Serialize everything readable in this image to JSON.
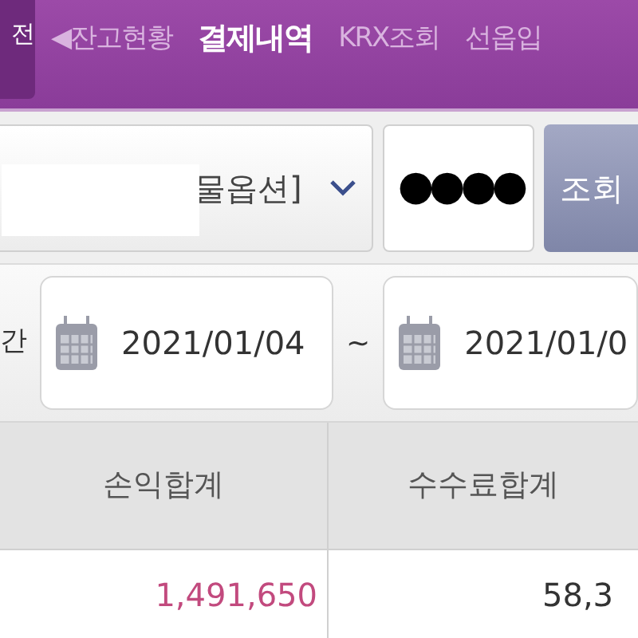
{
  "back_button": {
    "label": "전"
  },
  "tabs": [
    {
      "label": "◀잔고현황",
      "selected": false
    },
    {
      "label": "결제내역",
      "selected": true
    },
    {
      "label": "KRX조회",
      "selected": false
    },
    {
      "label": "선옵입",
      "selected": false
    }
  ],
  "account_select": {
    "value": "물옵션]"
  },
  "password": {
    "value": "●●●●"
  },
  "search_button": {
    "label": "조회"
  },
  "period": {
    "label": "간",
    "from": "2021/01/04",
    "separator": "~",
    "to": "2021/01/0"
  },
  "table": {
    "columns": [
      "손익합계",
      "수수료합계"
    ],
    "rows": [
      [
        "1,491,650",
        "58,3"
      ]
    ]
  }
}
